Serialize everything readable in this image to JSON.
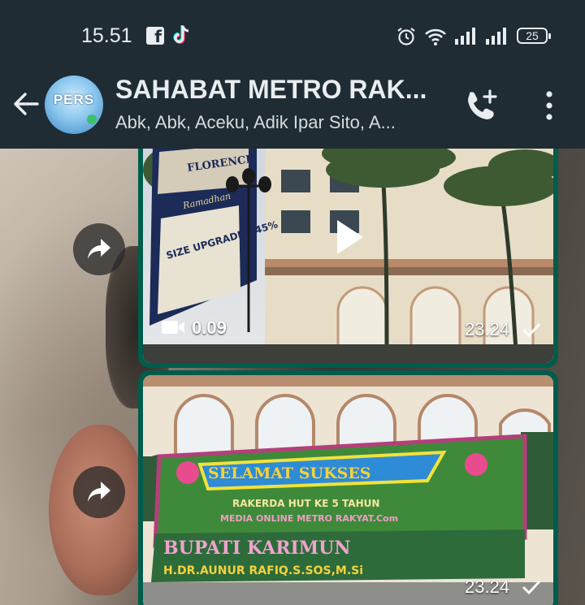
{
  "status_bar": {
    "time": "15.51",
    "battery": "25",
    "icons": [
      "facebook-icon",
      "tiktok-icon",
      "alarm-icon",
      "wifi-icon",
      "signal-icon",
      "signal-icon",
      "battery-icon"
    ]
  },
  "header": {
    "avatar_text": "PERS",
    "title": "SAHABAT METRO RAK...",
    "subtitle": "Abk, Abk, Aceku, Adik Ipar Sito, A...",
    "icons": [
      "back-arrow-icon",
      "add-call-icon",
      "more-vertical-icon"
    ]
  },
  "messages": [
    {
      "type": "video",
      "duration": "0.09",
      "time": "23.24",
      "sign_text": [
        "FLORENCE",
        "Ramadhan",
        "SIZE UPGRADE +45%"
      ]
    },
    {
      "type": "image",
      "time": "23.24",
      "board_text": [
        "SELAMAT SUKSES",
        "RAKERDA HUT KE 5 TAHUN",
        "MEDIA ONLINE METRO RAKYAT.Com",
        "BUPATI KARIMUN",
        "H.DR.AUNUR RAFIQ.S.SOS,M.Si"
      ]
    }
  ],
  "colors": {
    "header_bg": "#1f2c34",
    "bubble_out": "#005c4b",
    "text_primary": "#e9edef"
  }
}
